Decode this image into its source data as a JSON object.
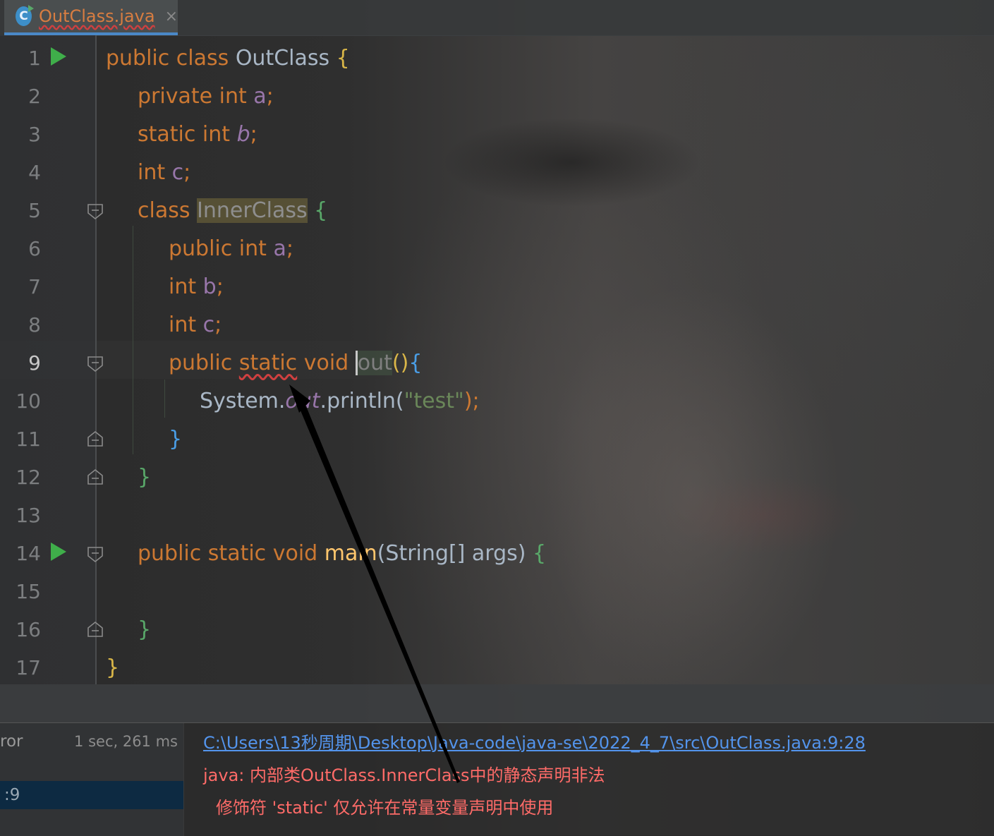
{
  "tab": {
    "icon_letter": "C",
    "file_name": "OutClass.java",
    "close_glyph": "×"
  },
  "editor": {
    "line_numbers": [
      "1",
      "2",
      "3",
      "4",
      "5",
      "6",
      "7",
      "8",
      "9",
      "10",
      "11",
      "12",
      "13",
      "14",
      "15",
      "16",
      "17"
    ],
    "current_line": "9",
    "lines": {
      "l1": {
        "t1": "public class ",
        "t2": "OutClass ",
        "t3": "{"
      },
      "l2": {
        "t1": "private int ",
        "t2": "a",
        "t3": ";"
      },
      "l3": {
        "t1": "static int ",
        "t2": "b",
        "t3": ";"
      },
      "l4": {
        "t1": "int ",
        "t2": "c",
        "t3": ";"
      },
      "l5": {
        "t1": "class ",
        "t2": "InnerClass",
        "t3": " {"
      },
      "l6": {
        "t1": "public int ",
        "t2": "a",
        "t3": ";"
      },
      "l7": {
        "t1": "int ",
        "t2": "b",
        "t3": ";"
      },
      "l8": {
        "t1": "int ",
        "t2": "c",
        "t3": ";"
      },
      "l9": {
        "t1": "public ",
        "t2": "static",
        "t3": " void ",
        "t4": "out",
        "t5": "()",
        "t6": "{"
      },
      "l10": {
        "t1": "System.",
        "t2": "out",
        "t3": ".println(",
        "t4": "\"test\"",
        "t5": ");"
      },
      "l11": {
        "t1": "}"
      },
      "l12": {
        "t1": "}"
      },
      "l14": {
        "t1": "public static void ",
        "t2": "main",
        "t3": "(String[] args) ",
        "t4": "{"
      },
      "l16": {
        "t1": "}"
      },
      "l17": {
        "t1": "}"
      }
    }
  },
  "build": {
    "tree_row1_label": "ror",
    "tree_row1_time": "1 sec, 261 ms",
    "tree_row2_label": ":9",
    "link": "C:\\Users\\13秒周期\\Desktop\\Java-code\\java-se\\2022_4_7\\src\\OutClass.java:9:28",
    "error_line1": "java: 内部类OutClass.InnerClass中的静态声明非法",
    "error_line2": "修饰符 'static' 仅允许在常量变量声明中使用"
  },
  "colors": {
    "keyword": "#cc7832",
    "field": "#9876aa",
    "string": "#6a8759",
    "error": "#ff6b68",
    "link": "#5394ec",
    "run_icon": "#3fae4a"
  }
}
